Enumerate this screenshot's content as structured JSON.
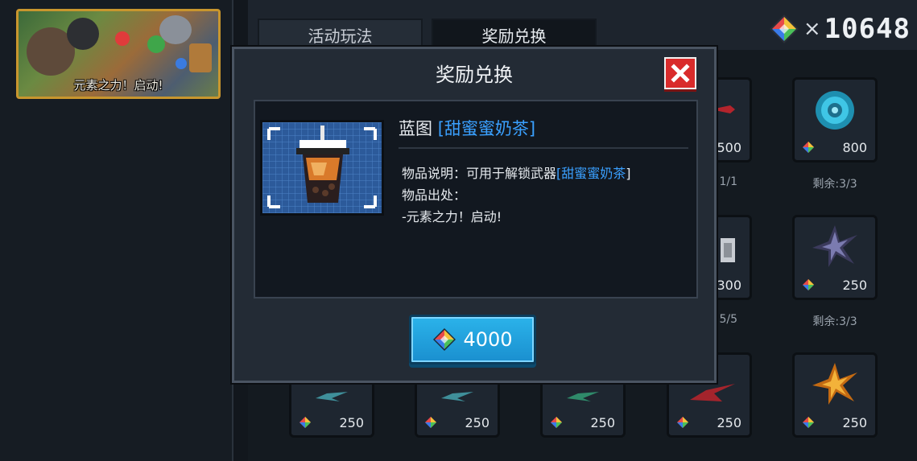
{
  "sidebar": {
    "event_caption": "元素之力！启动!"
  },
  "tabs": [
    {
      "label": "活动玩法",
      "active": false
    },
    {
      "label": "奖励兑换",
      "active": true
    }
  ],
  "currency": {
    "icon": "rainbow-gem-icon",
    "multiplier": "×",
    "amount": "10648"
  },
  "shop": {
    "slots": [
      {
        "price": "500",
        "remaining": "1/1",
        "icon": "red-weapon-icon"
      },
      {
        "price": "800",
        "remaining": "剩余:3/3",
        "icon": "blue-orb-icon"
      },
      {
        "price": "300",
        "remaining": "5/5",
        "icon": "gray-block-icon"
      },
      {
        "price": "250",
        "remaining": "剩余:3/3",
        "icon": "dark-crystal-icon"
      },
      {
        "price": "250",
        "remaining": "",
        "icon": "teal-weapon-icon"
      },
      {
        "price": "250",
        "remaining": "",
        "icon": "teal-weapon-icon"
      },
      {
        "price": "250",
        "remaining": "",
        "icon": "green-weapon-icon"
      },
      {
        "price": "250",
        "remaining": "",
        "icon": "red-weapon-icon"
      },
      {
        "price": "250",
        "remaining": "",
        "icon": "orange-crystal-icon"
      }
    ]
  },
  "modal": {
    "title": "奖励兑换",
    "item_name_prefix": "蓝图 ",
    "item_name_open": "[",
    "item_name_highlight": "甜蜜蜜奶茶",
    "item_name_close": "]",
    "desc_label": "物品说明：可用于解锁武器",
    "desc_open": "[",
    "desc_highlight": "甜蜜蜜奶茶",
    "desc_close": "]",
    "source_label": "物品出处：",
    "source_value": "-元素之力！启动!",
    "buy_cost": "4000",
    "accent_color": "#3aa0ff"
  }
}
